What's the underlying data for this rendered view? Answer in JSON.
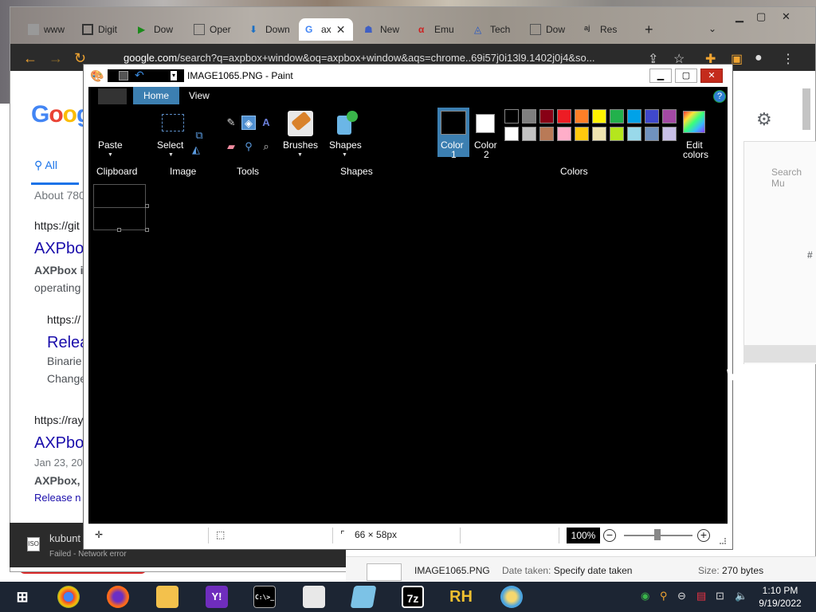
{
  "browser": {
    "tabs": [
      {
        "label": "www",
        "icon": "image-icon"
      },
      {
        "label": "Digit",
        "icon": "trash-icon"
      },
      {
        "label": "Dow",
        "icon": "play-icon"
      },
      {
        "label": "Oper",
        "icon": "doc-icon"
      },
      {
        "label": "Down",
        "icon": "download-icon"
      },
      {
        "label": "ax",
        "icon": "google-icon",
        "active": true
      },
      {
        "label": "New",
        "icon": "people-icon"
      },
      {
        "label": "Emu",
        "icon": "alpha-icon"
      },
      {
        "label": "Tech",
        "icon": "triangle-icon"
      },
      {
        "label": "Dow",
        "icon": "doc-icon"
      },
      {
        "label": "Res",
        "icon": "aj-icon"
      }
    ],
    "url_host": "google.com",
    "url_rest": "/search?q=axpbox+window&oq=axpbox+window&aqs=chrome..69i57j0i13l9.1402j0j4&so...",
    "google": {
      "logo": "Goog",
      "tab_all": "All",
      "about": "About 780",
      "result1_url": "https://git",
      "result1_title": "AXPbox",
      "result1_snippet_a": "AXPbox i",
      "result1_snippet_b": "operating",
      "sub_url": "https://",
      "sub_title": "Relea",
      "sub_line1": "Binarie",
      "sub_line2": "Change",
      "result2_url": "https://ray",
      "result2_title": "AXPbo",
      "result2_date": "Jan 23, 20",
      "result2_snippet": "AXPbox, t",
      "result2_link": "Release n",
      "search_mu": "Search Mu",
      "hash": "#"
    }
  },
  "download": {
    "name": "kubunt",
    "status": "Failed - Network error",
    "icon_text": "ISO"
  },
  "explorer": {
    "filename": "IMAGE1065.PNG",
    "date_label": "Date taken:",
    "date_value": "Specify date taken",
    "size_label": "Size:",
    "size_value": "270 bytes"
  },
  "paint": {
    "title": "IMAGE1065.PNG - Paint",
    "tabs": {
      "home": "Home",
      "view": "View"
    },
    "help": "?",
    "groups": {
      "clipboard": "Clipboard",
      "image": "Image",
      "tools": "Tools",
      "shapes": "Shapes",
      "colors": "Colors"
    },
    "buttons": {
      "paste": "Paste",
      "select": "Select",
      "brushes": "Brushes",
      "shapes": "Shapes",
      "color1_a": "Color",
      "color1_b": "1",
      "color2_a": "Color",
      "color2_b": "2",
      "edit_a": "Edit",
      "edit_b": "colors"
    },
    "palette": [
      "#000000",
      "#7f7f7f",
      "#880015",
      "#ed1c24",
      "#ff7f27",
      "#fff200",
      "#22b14c",
      "#00a2e8",
      "#3f48cc",
      "#a349a4",
      "#ffffff",
      "#c3c3c3",
      "#b97a57",
      "#ffaec9",
      "#ffc90e",
      "#efe4b0",
      "#b5e61d",
      "#99d9ea",
      "#7092be",
      "#c8bfe7"
    ],
    "color1": "#000000",
    "color2": "#ffffff",
    "status": {
      "size": "66 × 58px",
      "zoom": "100%"
    }
  },
  "taskbar": {
    "apps": [
      "windows-start",
      "chrome",
      "firefox",
      "file-explorer",
      "yahoo",
      "cmd",
      "notepad",
      "editor",
      "7zip",
      "resource-hacker",
      "paint"
    ],
    "app_labels": {
      "sevenzip": "7z",
      "rh": "RH",
      "yahoo": "Y!",
      "cmd": "C:\\>_"
    },
    "time": "1:10 PM",
    "date": "9/19/2022"
  }
}
